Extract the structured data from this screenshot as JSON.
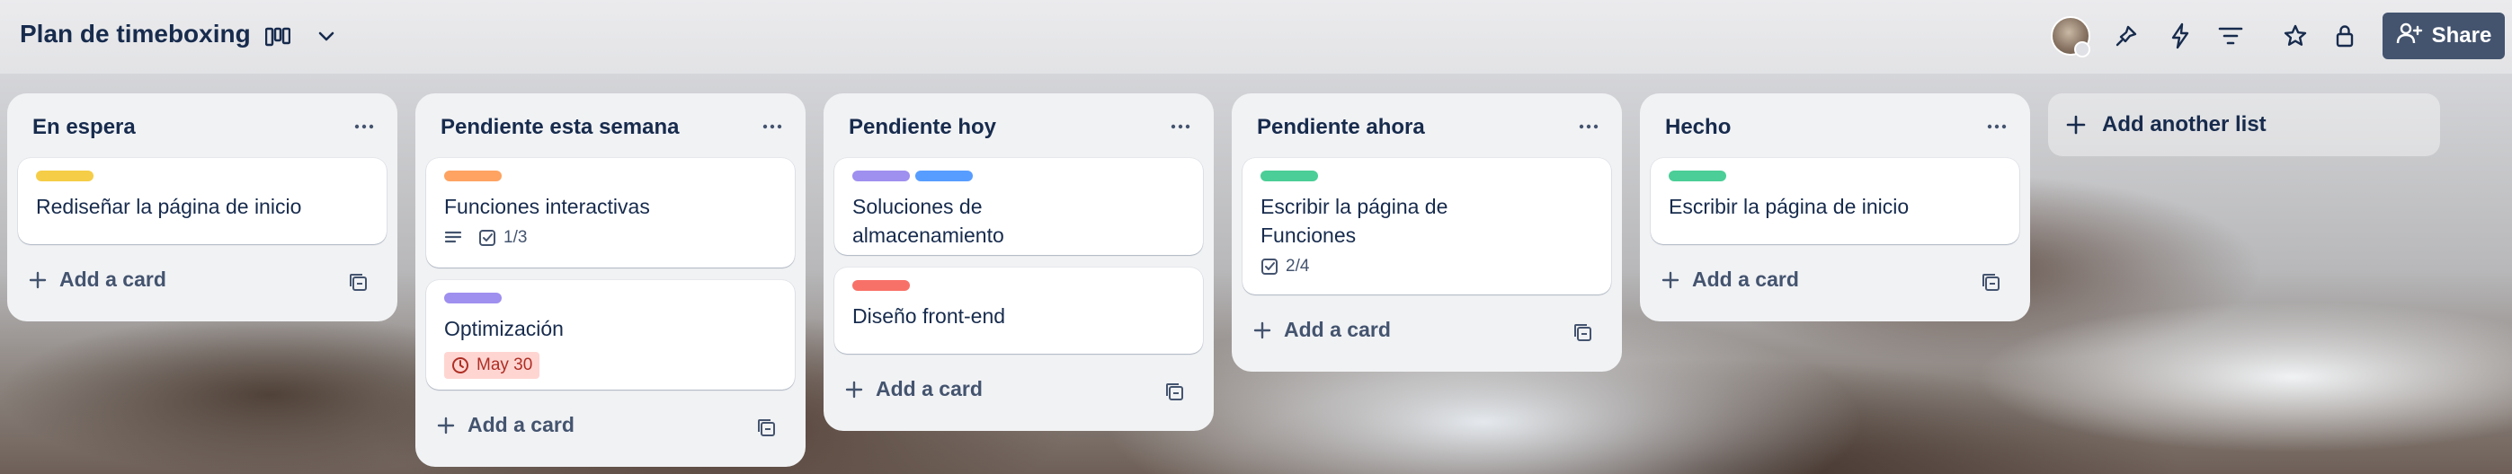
{
  "board": {
    "title": "Plan de timeboxing",
    "share_label": "Share"
  },
  "header_icons": [
    "board-view-icon",
    "chevron-down-icon",
    "power-ups-icon",
    "automation-icon",
    "filter-icon",
    "star-icon",
    "visibility-icon",
    "add-member-icon"
  ],
  "lists": [
    {
      "title": "En espera",
      "cards": [
        {
          "labels": [
            "#f5cd47"
          ],
          "title": "Rediseñar la página de inicio"
        }
      ],
      "add_card": "Add a card"
    },
    {
      "title": "Pendiente esta semana",
      "cards": [
        {
          "labels": [
            "#fea362"
          ],
          "title": "Funciones interactivas",
          "checklist": "1/3",
          "has_description": true
        },
        {
          "labels": [
            "#9f8fef"
          ],
          "title": "Optimización",
          "due": "May 30"
        }
      ],
      "add_card": "Add a card"
    },
    {
      "title": "Pendiente hoy",
      "cards": [
        {
          "labels": [
            "#9f8fef",
            "#579dff"
          ],
          "title": "Soluciones de almacenamiento"
        },
        {
          "labels": [
            "#f87168"
          ],
          "title": "Diseño front-end"
        }
      ],
      "add_card": "Add a card"
    },
    {
      "title": "Pendiente ahora",
      "cards": [
        {
          "labels": [
            "#4bce97"
          ],
          "title": "Escribir la página de Funciones",
          "checklist": "2/4"
        }
      ],
      "add_card": "Add a card"
    },
    {
      "title": "Hecho",
      "cards": [
        {
          "labels": [
            "#4bce97"
          ],
          "title": "Escribir la página de inicio"
        }
      ],
      "add_card": "Add a card"
    }
  ],
  "add_list_label": "Add another list",
  "colors": {
    "list_bg": "#f1f2f4",
    "text": "#172b4d",
    "muted": "#44546f",
    "share_bg": "#44546f",
    "due_bg": "#ffd5d2",
    "due_text": "#ae2e24"
  }
}
